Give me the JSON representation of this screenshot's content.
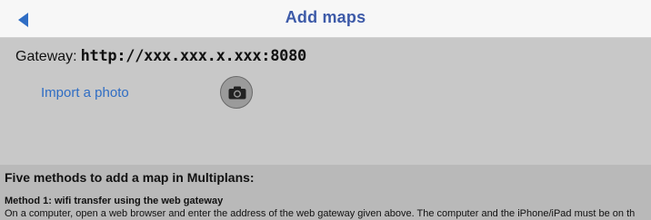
{
  "header": {
    "title": "Add maps",
    "back_icon": "chevron-left-icon",
    "accent_color": "#2f6dc4"
  },
  "gateway": {
    "label": "Gateway:",
    "url": "http://xxx.xxx.x.xxx:8080"
  },
  "import": {
    "label": "Import a photo",
    "camera_icon": "camera-icon"
  },
  "methods": {
    "heading": "Five methods to add a map in Multiplans:",
    "method1_title": "Method 1: wifi transfer using the web gateway",
    "method1_text": "On a computer, open a web browser and enter the address of the web gateway given above. The computer and the iPhone/iPad must be on th"
  }
}
